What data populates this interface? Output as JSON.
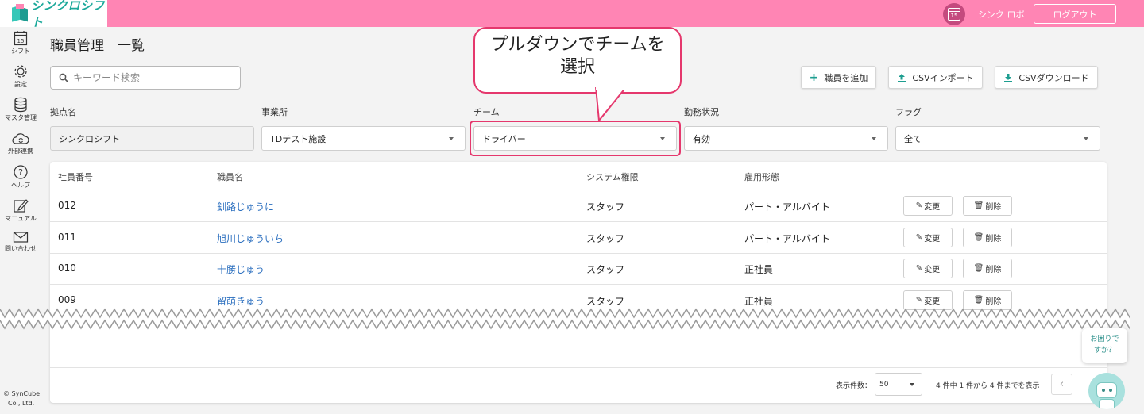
{
  "app": {
    "logo_text": "シンクロシフト"
  },
  "header": {
    "calendar_day": "15",
    "user_name": "シンク ロボ",
    "logout_label": "ログアウト"
  },
  "sidebar": {
    "items": [
      {
        "label": "シフト",
        "icon": "calendar-icon",
        "day": "15"
      },
      {
        "label": "設定",
        "icon": "gear-icon"
      },
      {
        "label": "マスタ管理",
        "icon": "database-icon"
      },
      {
        "label": "外部連携",
        "icon": "cloud-sync-icon"
      },
      {
        "label": "ヘルプ",
        "icon": "help-icon"
      },
      {
        "label": "マニュアル",
        "icon": "manual-icon"
      },
      {
        "label": "問い合わせ",
        "icon": "mail-icon"
      }
    ],
    "copyright_line1": "© SynCube",
    "copyright_line2": "Co., Ltd."
  },
  "page": {
    "title": "職員管理　一覧"
  },
  "search": {
    "placeholder": "キーワード検索",
    "value": ""
  },
  "toolbar": {
    "add_label": "職員を追加",
    "import_label": "CSVインポート",
    "download_label": "CSVダウンロード"
  },
  "filters": [
    {
      "label": "拠点名",
      "value": "シンクロシフト"
    },
    {
      "label": "事業所",
      "value": "TDテスト施設"
    },
    {
      "label": "チーム",
      "value": "ドライバー"
    },
    {
      "label": "勤務状況",
      "value": "有効"
    },
    {
      "label": "フラグ",
      "value": "全て"
    }
  ],
  "callout": {
    "line1": "プルダウンでチームを",
    "line2": "選択"
  },
  "table": {
    "headers": [
      "社員番号",
      "職員名",
      "システム権限",
      "雇用形態"
    ],
    "rows": [
      {
        "id": "012",
        "name": "釧路じゅうに",
        "role": "スタッフ",
        "type": "パート・アルバイト"
      },
      {
        "id": "011",
        "name": "旭川じゅういち",
        "role": "スタッフ",
        "type": "パート・アルバイト"
      },
      {
        "id": "010",
        "name": "十勝じゅう",
        "role": "スタッフ",
        "type": "正社員"
      },
      {
        "id": "009",
        "name": "留萌きゅう",
        "role": "スタッフ",
        "type": "正社員"
      }
    ],
    "edit_label": "変更",
    "delete_label": "削除"
  },
  "pagination": {
    "per_page_label": "表示件数：",
    "per_page_value": "50",
    "range_text": "4 件中 1 件から 4 件までを表示"
  },
  "help_bubble": {
    "line1": "お困りで",
    "line2": "すか？"
  },
  "colors": {
    "header": "#ff85b4",
    "accent": "#1d9e90",
    "highlight": "#e5386d",
    "link": "#2b6fbf"
  }
}
